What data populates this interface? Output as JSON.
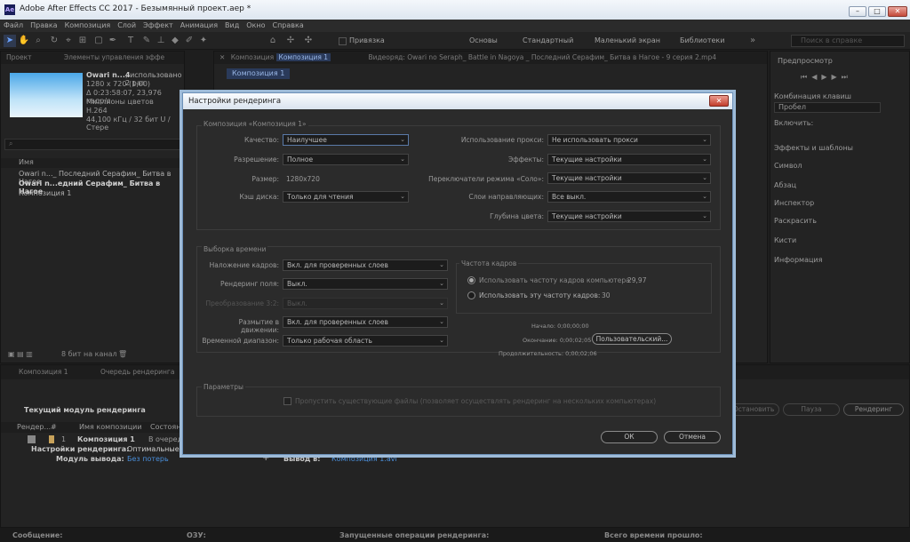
{
  "window": {
    "logo": "Ae",
    "title": "Adobe After Effects CC 2017 - Безымянный проект.aep *"
  },
  "menu": [
    "Файл",
    "Правка",
    "Композиция",
    "Слой",
    "Эффект",
    "Анимация",
    "Вид",
    "Окно",
    "Справка"
  ],
  "toolbar": {
    "snap_label": "Привязка",
    "workspaces": [
      "Основы",
      "Стандартный",
      "Маленький экран",
      "Библиотеки"
    ],
    "search_placeholder": "Поиск в справке"
  },
  "project_panel": {
    "tabs": [
      "Проект",
      "Элементы управления эффе"
    ],
    "footage_name": "Owari n...4",
    "footage_used": ", использовано 2 раз",
    "info_lines": [
      "1280 x 720 (1,00)",
      "Δ 0:23:58:07, 23,976 кадр/с",
      "Миллионы цветов",
      "H.264",
      "44,100 кГц / 32 бит U / Стере"
    ],
    "column_name": "Имя",
    "items": [
      "Owari n..._ Последний Серафим_ Битва в Нагое",
      "Owari n...едний Серафим_ Битва в Нагое",
      "Композиция 1"
    ],
    "bit_depth": "8 бит на канал"
  },
  "comp_panel": {
    "tab_label": "Композиция",
    "tab_comp": "Композиция 1",
    "footage_tab": "Видеоряд: Owari no Seraph_ Battle in Nagoya _ Последний Серафим_ Битва в Нагое - 9 серия 2.mp4",
    "breadcrumb": "Композиция 1"
  },
  "right_panel": {
    "preview_title": "Предпросмотр",
    "shortcut_label": "Комбинация клавиш",
    "shortcut_value": "Пробел",
    "include_label": "Включить:",
    "items": [
      "Эффекты и шаблоны",
      "Символ",
      "Абзац",
      "Инспектор",
      "Раскрасить",
      "Кисти",
      "Информация"
    ]
  },
  "render_queue": {
    "tabs": [
      "Композиция 1",
      "Очередь рендеринга"
    ],
    "current_module": "Текущий модуль рендеринга",
    "buttons": [
      "Остановить",
      "Пауза",
      "Рендеринг"
    ],
    "columns": [
      "Рендер...",
      "#",
      "Имя композиции",
      "Состояние"
    ],
    "row_num": "1",
    "row_name": "Композиция 1",
    "row_status": "В очереди",
    "render_settings_label": "Настройки рендеринга:",
    "render_settings_value": "Оптимальные наст",
    "output_module_label": "Модуль вывода:",
    "output_module_value": "Без потерь",
    "output_to_label": "Вывод в:",
    "output_to_value": "Композиция 1.avi"
  },
  "status_bar": {
    "message": "Сообщение:",
    "ram": "ОЗУ:",
    "started": "Запущенные операции рендеринга:",
    "elapsed": "Всего времени прошло:"
  },
  "dialog": {
    "title": "Настройки рендеринга",
    "comp_group": "Композиция «Композиция 1»",
    "quality_label": "Качество:",
    "quality": "Наилучшее",
    "resolution_label": "Разрешение:",
    "resolution": "Полное",
    "size_label": "Размер:",
    "size": "1280x720",
    "disk_cache_label": "Кэш диска:",
    "disk_cache": "Только для чтения",
    "proxy_label": "Использование прокси:",
    "proxy": "Не использовать прокси",
    "effects_label": "Эффекты:",
    "effects": "Текущие настройки",
    "solo_label": "Переключатели режима «Соло»:",
    "solo": "Текущие настройки",
    "guide_label": "Слои направляющих:",
    "guide": "Все выкл.",
    "color_depth_label": "Глубина цвета:",
    "color_depth": "Текущие настройки",
    "time_group": "Выборка времени",
    "frame_blend_label": "Наложение кадров:",
    "frame_blend": "Вкл. для проверенных слоев",
    "field_render_label": "Рендеринг поля:",
    "field_render": "Выкл.",
    "pulldown_label": "Преобразование 3:2:",
    "pulldown": "Выкл.",
    "motion_blur_label": "Размытие в движении:",
    "motion_blur": "Вкл. для проверенных слоев",
    "time_span_label": "Временной диапазон:",
    "time_span": "Только рабочая область",
    "fps_group": "Частота кадров",
    "fps_comp_label": "Использовать частоту кадров компьютера",
    "fps_comp_value": "29,97",
    "fps_this_label": "Использовать эту частоту кадров:",
    "fps_this_value": "30",
    "start": "Начало: 0;00;00;00",
    "end": "Окончание: 0;00;02;05",
    "duration": "Продолжительность: 0;00;02;06",
    "custom_button": "Пользовательский...",
    "options_group": "Параметры",
    "skip_files": "Пропустить существующие файлы (позволяет осуществлять рендеринг на нескольких компьютерах)",
    "ok": "ОК",
    "cancel": "Отмена"
  }
}
